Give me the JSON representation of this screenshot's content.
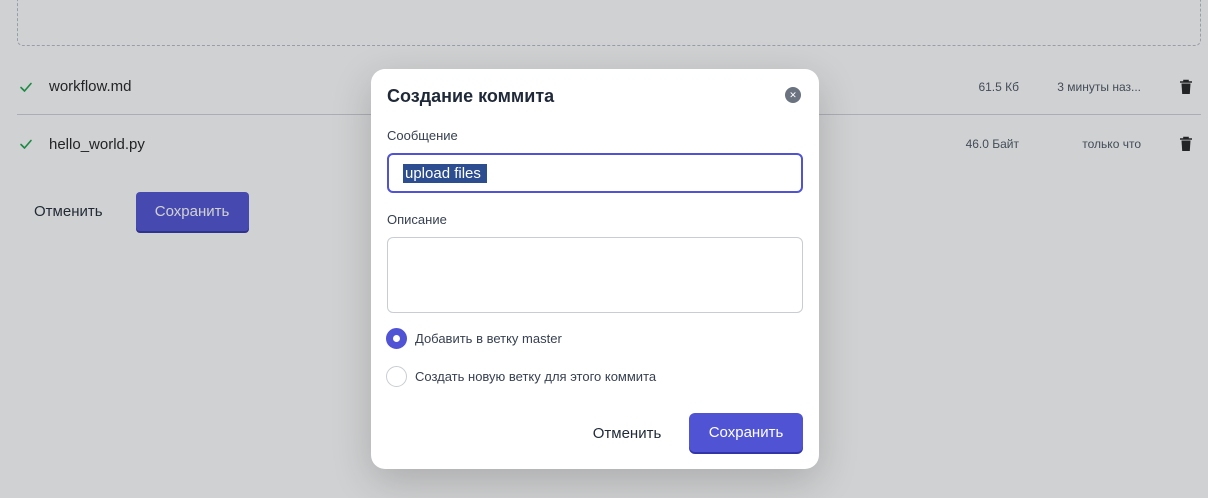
{
  "files": [
    {
      "name": "workflow.md",
      "size": "61.5 Кб",
      "time": "3 минуты наз..."
    },
    {
      "name": "hello_world.py",
      "size": "46.0 Байт",
      "time": "только что"
    }
  ],
  "page_actions": {
    "cancel_label": "Отменить",
    "save_label": "Сохранить"
  },
  "modal": {
    "title": "Создание коммита",
    "message_label": "Сообщение",
    "message_value": "upload files ",
    "description_label": "Описание",
    "description_value": "",
    "radio_existing_branch": "Добавить в ветку master",
    "radio_new_branch": "Создать новую ветку для этого коммита",
    "cancel_label": "Отменить",
    "save_label": "Сохранить"
  },
  "colors": {
    "accent": "#4f53d4",
    "check": "#16a34a",
    "selection": "#2c4d8f"
  }
}
